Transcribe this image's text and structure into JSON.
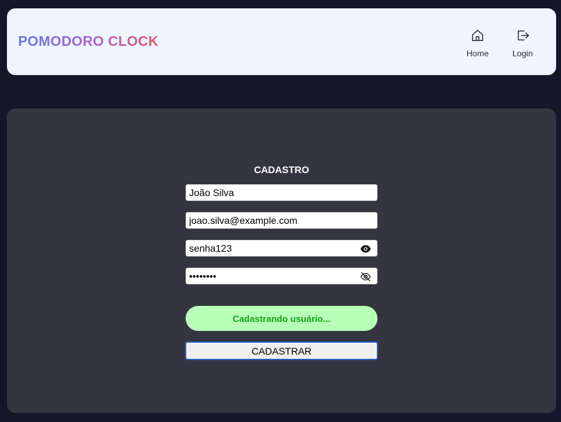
{
  "header": {
    "logo": "POMODORO CLOCK",
    "nav": [
      {
        "label": "Home",
        "icon": "home-icon"
      },
      {
        "label": "Login",
        "icon": "login-icon"
      }
    ]
  },
  "form": {
    "title": "CADASTRO",
    "name_value": "João Silva",
    "email_value": "joao.silva@example.com",
    "password_value": "senha123",
    "password_visible": true,
    "confirm_value": "senha123",
    "confirm_visible": false,
    "status": "Cadastrando usuário...",
    "submit_label": "CADASTRAR"
  },
  "colors": {
    "page_bg": "#16162a",
    "header_bg": "#eef5ff",
    "panel_bg": "#353542",
    "status_bg": "#b7ffb7",
    "status_text": "#16a316",
    "focus_border": "#2a5fbf"
  }
}
